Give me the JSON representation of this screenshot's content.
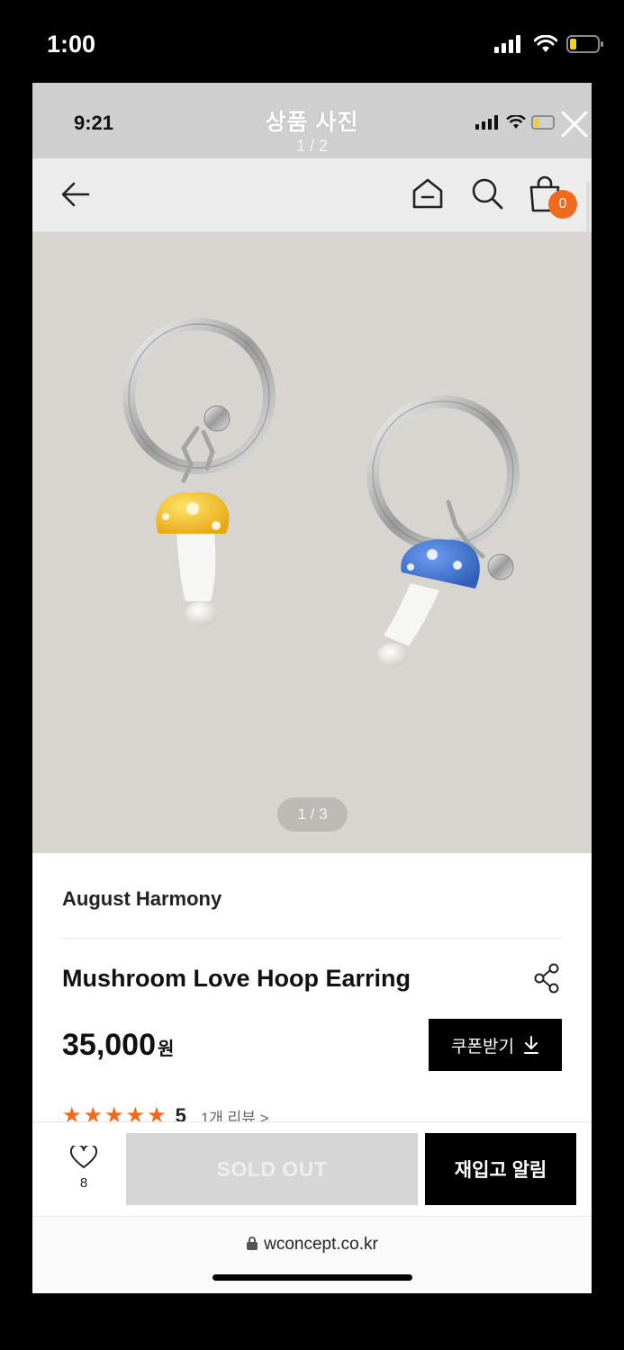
{
  "outer_status": {
    "time": "1:00",
    "icons": [
      "signal-icon",
      "wifi-icon",
      "battery-icon"
    ]
  },
  "inner_status": {
    "time": "9:21"
  },
  "viewer": {
    "title": "상품 사진",
    "counter": "1 / 2"
  },
  "nav": {
    "cart_count": "0"
  },
  "photo": {
    "pager": "1 / 3"
  },
  "product": {
    "brand": "August Harmony",
    "name": "Mushroom Love Hoop Earring",
    "price": "35,000",
    "price_unit": "원",
    "coupon_label": "쿠폰받기",
    "rating_value": "5",
    "rating_stars": 5,
    "review_link": "1개 리뷰 >"
  },
  "actions": {
    "wish_count": "8",
    "sold_out_label": "SOLD OUT",
    "restock_label": "재입고 알림"
  },
  "browser": {
    "url": "wconcept.co.kr"
  },
  "colors": {
    "accent": "#f06a1d",
    "mushroom_yellow": "#f5c62a",
    "mushroom_blue": "#4a7fd6"
  }
}
